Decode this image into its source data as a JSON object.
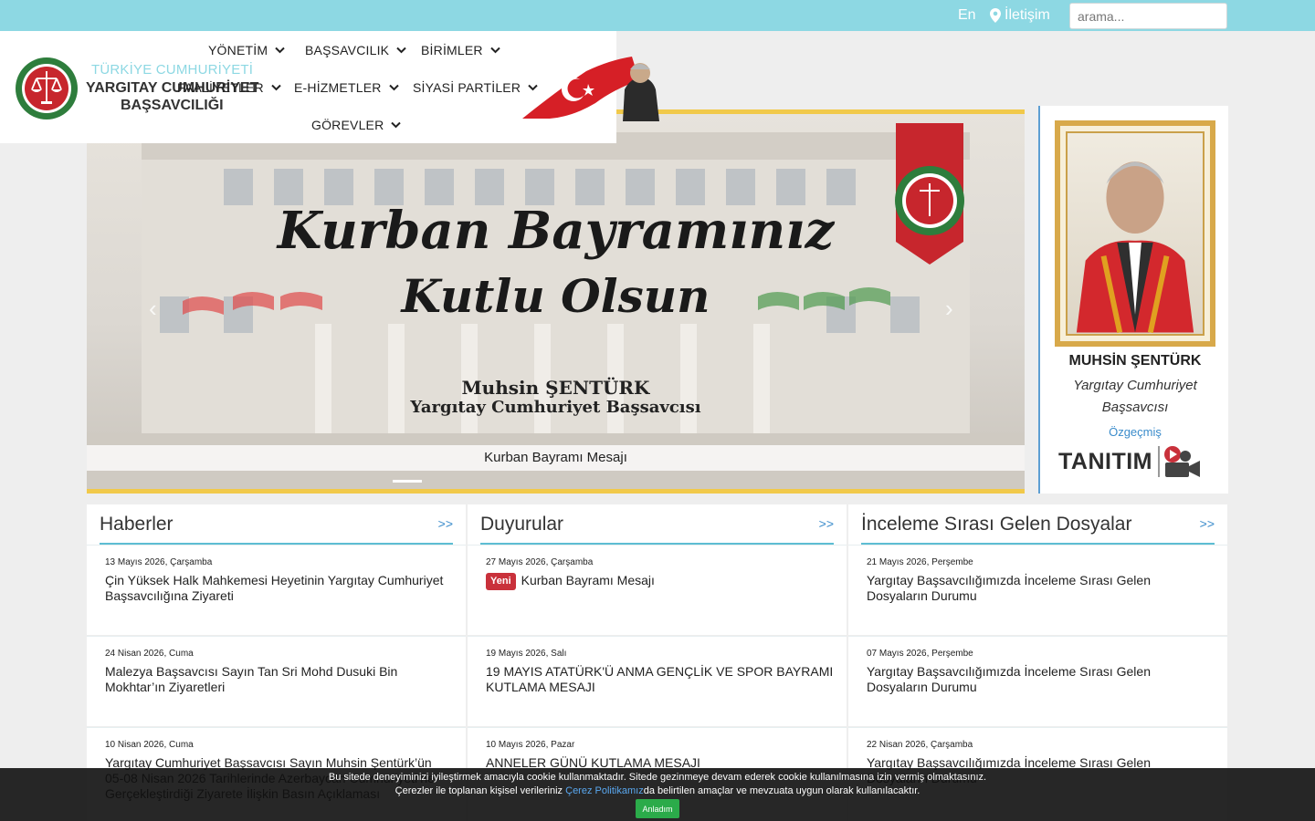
{
  "topbar": {
    "lang": "En",
    "contact": "İletişim",
    "search_placeholder": "arama..."
  },
  "header": {
    "org_line1": "TÜRKİYE CUMHURİYETİ",
    "org_line2": "YARGITAY CUMHURİYET",
    "org_line3": "BAŞSAVCILIĞI",
    "nav": [
      {
        "label": "YÖNETİM"
      },
      {
        "label": "BAŞSAVCILIK"
      },
      {
        "label": "BİRİMLER"
      },
      {
        "label": "FAALİYETLER"
      },
      {
        "label": "E-HİZMETLER"
      },
      {
        "label": "SİYASİ PARTİLER"
      },
      {
        "label": "GÖREVLER"
      }
    ]
  },
  "slider": {
    "title_line1": "Kurban Bayramınız",
    "title_line2": "Kutlu Olsun",
    "signature_name": "Muhsin ŞENTÜRK",
    "signature_role": "Yargıtay Cumhuriyet Başsavcısı",
    "caption": "Kurban Bayramı Mesajı"
  },
  "profile": {
    "name": "MUHSİN ŞENTÜRK",
    "role": "Yargıtay Cumhuriyet Başsavcısı",
    "bio_link": "Özgeçmiş",
    "promo": "TANITIM"
  },
  "columns": [
    {
      "title": "Haberler",
      "more": ">>",
      "items": [
        {
          "date": "13 Mayıs 2026, Çarşamba",
          "text": "Çin Yüksek Halk Mahkemesi Heyetinin Yargıtay Cumhuriyet Başsavcılığına Ziyareti"
        },
        {
          "date": "24 Nisan 2026, Cuma",
          "text": "Malezya Başsavcısı Sayın Tan Sri Mohd Dusuki Bin Mokhtar’ın Ziyaretleri"
        },
        {
          "date": "10 Nisan 2026, Cuma",
          "text": "Yargıtay Cumhuriyet Başsavcısı Sayın Muhsin Şentürk’ün 05-08 Nisan 2026 Tarihlerinde Azerbaycan Cumhuriyeti’ne Gerçekleştirdiği Ziyarete İlişkin Basın Açıklaması"
        }
      ]
    },
    {
      "title": "Duyurular",
      "more": ">>",
      "items": [
        {
          "date": "27 Mayıs 2026, Çarşamba",
          "badge": "Yeni",
          "text": "Kurban Bayramı Mesajı"
        },
        {
          "date": "19 Mayıs 2026, Salı",
          "text": "19 MAYIS ATATÜRK'Ü ANMA GENÇLİK VE SPOR BAYRAMI KUTLAMA MESAJI"
        },
        {
          "date": "10 Mayıs 2026, Pazar",
          "text": "ANNELER GÜNÜ KUTLAMA MESAJI"
        }
      ]
    },
    {
      "title": "İnceleme Sırası Gelen Dosyalar",
      "more": ">>",
      "items": [
        {
          "date": "21 Mayıs 2026, Perşembe",
          "text": "Yargıtay Başsavcılığımızda İnceleme Sırası Gelen Dosyaların Durumu"
        },
        {
          "date": "07 Mayıs 2026, Perşembe",
          "text": "Yargıtay Başsavcılığımızda İnceleme Sırası Gelen Dosyaların Durumu"
        },
        {
          "date": "22 Nisan 2026, Çarşamba",
          "text": "Yargıtay Başsavcılığımızda İnceleme Sırası Gelen Dosyaların Durumu"
        }
      ]
    }
  ],
  "cookie": {
    "line1": "Bu sitede deneyiminizi iyileştirmek amacıyla cookie kullanmaktadır. Sitede gezinmeye devam ederek cookie kullanılmasına izin vermiş olmaktasınız.",
    "line2_before": "Çerezler ile toplanan kişisel verileriniz",
    "link": "Çerez Politikamız",
    "line2_after": "da belirtilen amaçlar ve mevzuata uygun olarak kullanılacaktır.",
    "accept": "Anladım"
  },
  "colors": {
    "topbar": "#8dd8e3",
    "accent_line": "#5dbdd3",
    "link": "#3b8ccb",
    "badge": "#c9313b",
    "accept": "#2bab4a",
    "frame_gold": "#d8a94a"
  }
}
